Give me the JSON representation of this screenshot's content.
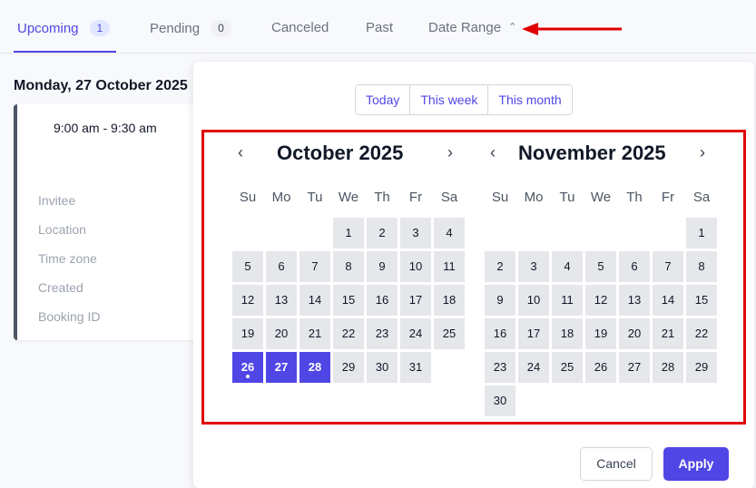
{
  "tabs": [
    {
      "label": "Upcoming",
      "badge": "1"
    },
    {
      "label": "Pending",
      "badge": "0"
    },
    {
      "label": "Canceled"
    },
    {
      "label": "Past"
    },
    {
      "label": "Date Range"
    }
  ],
  "booking": {
    "day_heading": "Monday, 27 October 2025",
    "time": "9:00 am - 9:30 am",
    "fields": [
      "Invitee",
      "Location",
      "Time zone",
      "Created",
      "Booking ID"
    ]
  },
  "date_picker": {
    "quick_ranges": [
      "Today",
      "This week",
      "This month"
    ],
    "weekdays": [
      "Su",
      "Mo",
      "Tu",
      "We",
      "Th",
      "Fr",
      "Sa"
    ],
    "months": [
      {
        "title": "October 2025",
        "first_weekday": 3,
        "days": 31,
        "selected": [
          26,
          27,
          28
        ],
        "today": 26
      },
      {
        "title": "November 2025",
        "first_weekday": 6,
        "days": 30,
        "selected": [],
        "today": null
      }
    ],
    "cancel_label": "Cancel",
    "apply_label": "Apply"
  },
  "colors": {
    "accent": "#4f46e5",
    "highlight": "#e00000"
  }
}
